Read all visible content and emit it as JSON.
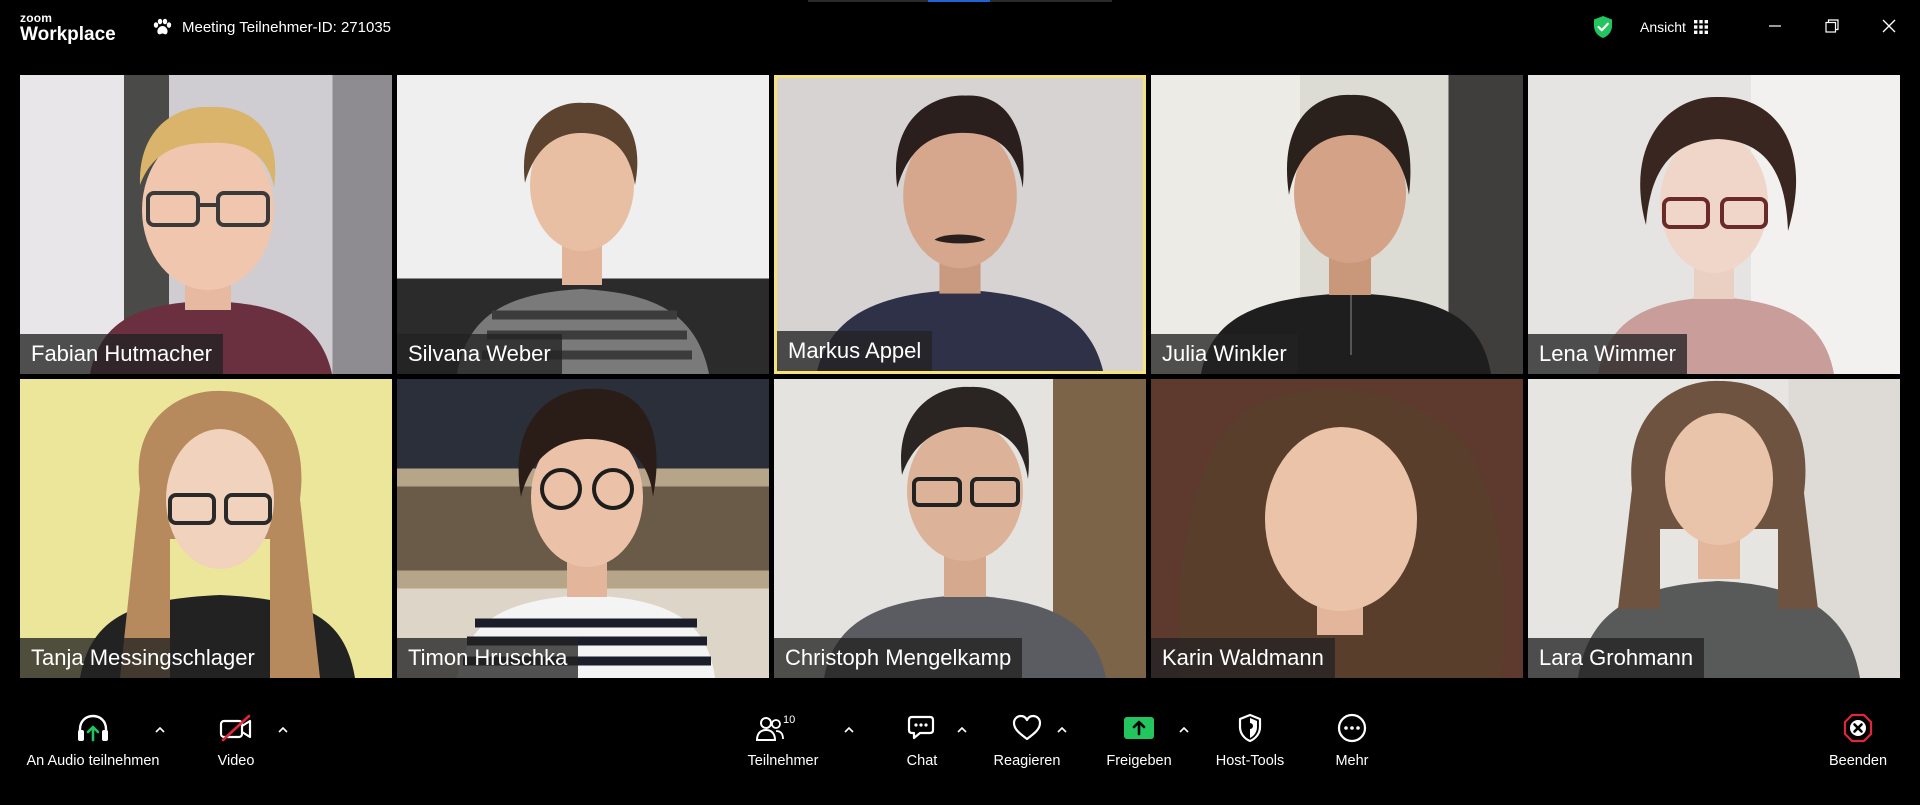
{
  "app": {
    "brand_top": "zoom",
    "brand_bottom": "Workplace"
  },
  "meeting": {
    "label": "Meeting Teilnehmer-ID: 271035"
  },
  "view": {
    "label": "Ansicht"
  },
  "colors": {
    "speaker_border": "#f5e27a",
    "accent_green": "#22c55e",
    "end_red": "#e0263a",
    "tab_active": "#1e64d6"
  },
  "participants": [
    {
      "name": "Fabian Hutmacher",
      "speaking": false
    },
    {
      "name": "Silvana Weber",
      "speaking": false
    },
    {
      "name": "Markus Appel",
      "speaking": true
    },
    {
      "name": "Julia Winkler",
      "speaking": false
    },
    {
      "name": "Lena Wimmer",
      "speaking": false
    },
    {
      "name": "Tanja Messingschlager",
      "speaking": false
    },
    {
      "name": "Timon Hruschka",
      "speaking": false
    },
    {
      "name": "Christoph Mengelkamp",
      "speaking": false
    },
    {
      "name": "Karin Waldmann",
      "speaking": false
    },
    {
      "name": "Lara Grohmann",
      "speaking": false
    }
  ],
  "toolbar": {
    "audio": {
      "label": "An Audio teilnehmen",
      "icon": "headphones-icon"
    },
    "video": {
      "label": "Video",
      "icon": "video-off-icon"
    },
    "participants": {
      "label": "Teilnehmer",
      "count": "10",
      "icon": "people-icon"
    },
    "chat": {
      "label": "Chat",
      "icon": "chat-icon"
    },
    "react": {
      "label": "Reagieren",
      "icon": "heart-icon"
    },
    "share": {
      "label": "Freigeben",
      "icon": "share-screen-icon"
    },
    "host": {
      "label": "Host-Tools",
      "icon": "shield-icon"
    },
    "more": {
      "label": "Mehr",
      "icon": "more-icon"
    },
    "end": {
      "label": "Beenden",
      "icon": "end-icon"
    }
  }
}
